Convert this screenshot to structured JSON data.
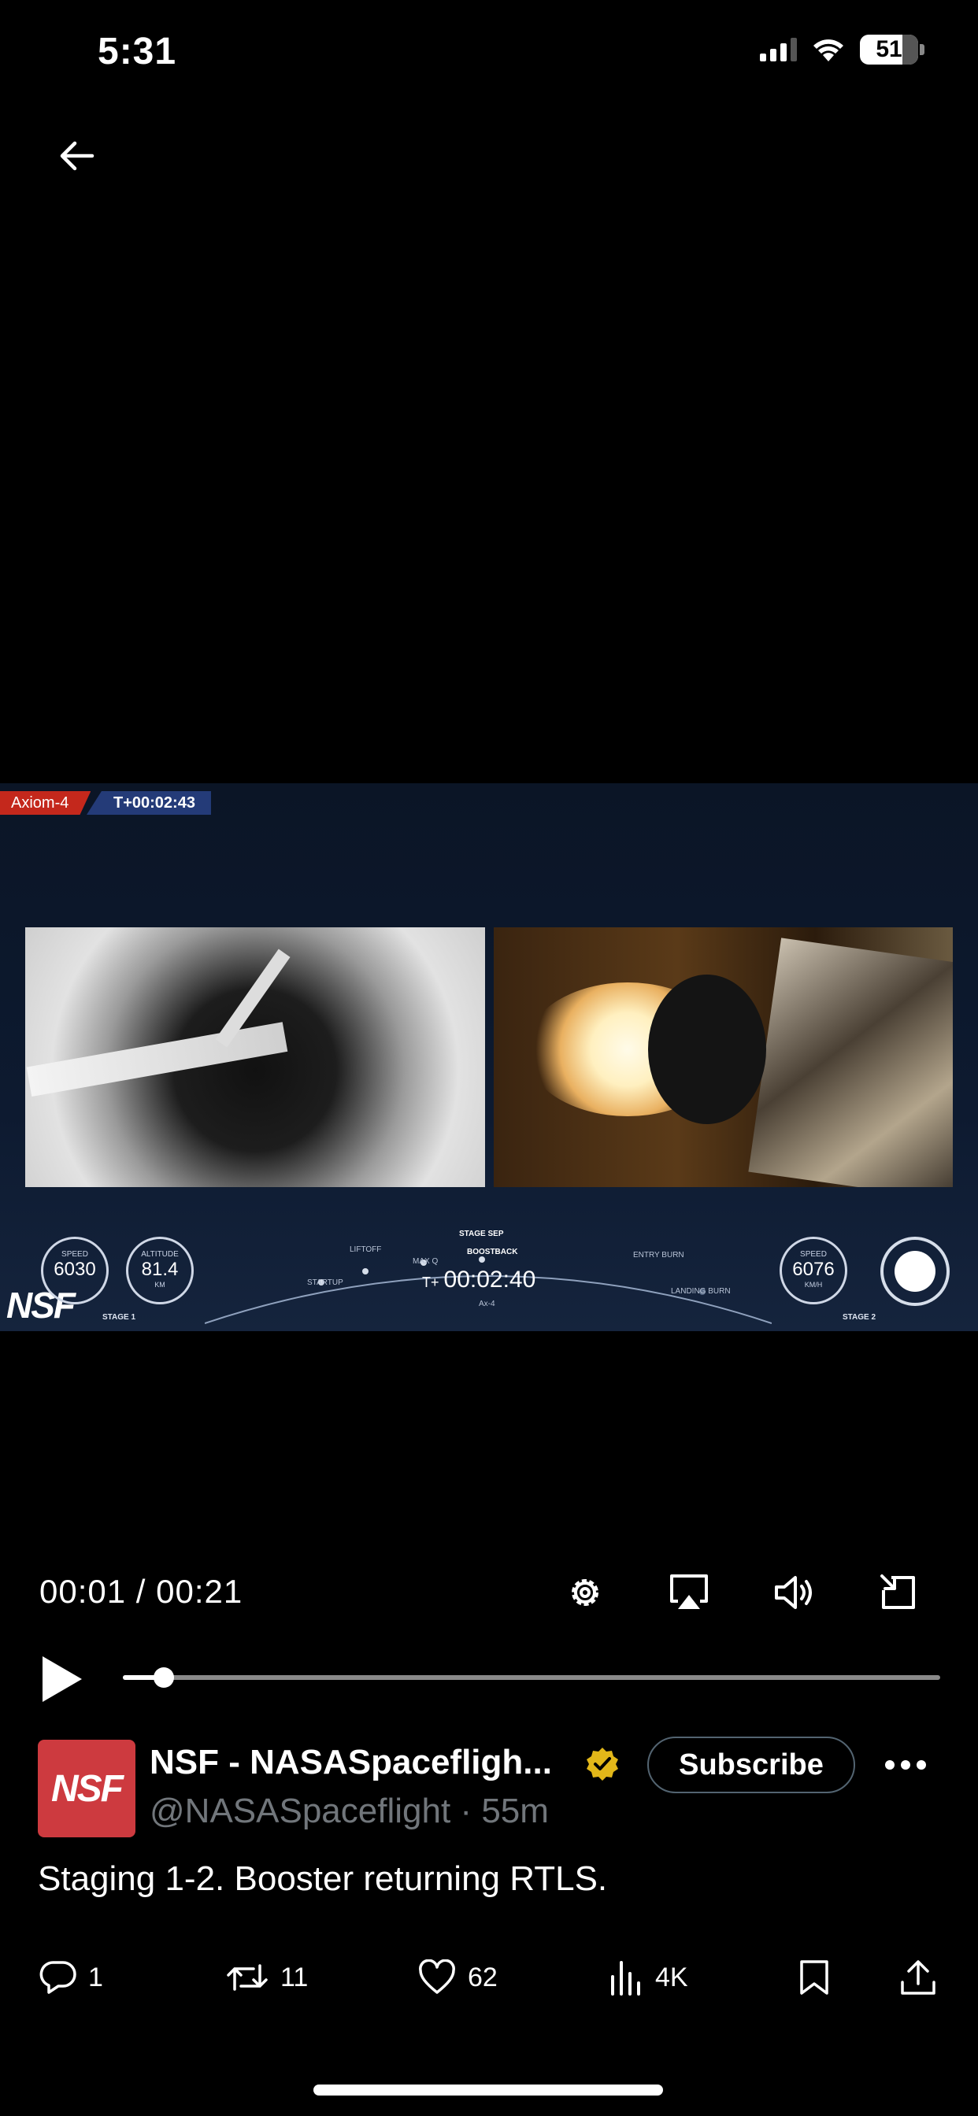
{
  "status_bar": {
    "time": "5:31",
    "battery": "51"
  },
  "video": {
    "mission_tag": "Axiom-4",
    "mission_clock": "T+00:02:43",
    "hud": {
      "logo": "NSF",
      "stage1": {
        "label": "STAGE 1",
        "speed_label": "SPEED",
        "speed_value": "6030",
        "altitude_label": "ALTITUDE",
        "altitude_value": "81.4",
        "altitude_unit": "KM"
      },
      "stage2": {
        "label": "STAGE 2",
        "speed_label": "SPEED",
        "speed_value": "6076",
        "speed_unit": "KM/H"
      },
      "clock_prefix": "T+",
      "clock": "00:02:40",
      "clock_sub": "Ax-4",
      "events": {
        "startup": "STARTUP",
        "liftoff": "LIFTOFF",
        "max_q": "MAX Q",
        "stage_sep": "STAGE SEP",
        "boostback": "BOOSTBACK",
        "entry_burn": "ENTRY BURN",
        "landing_burn": "LANDING BURN"
      }
    }
  },
  "player": {
    "time_readout": "00:01 / 00:21",
    "progress": 0.05,
    "icons": [
      "gear-icon",
      "airplay-icon",
      "volume-icon",
      "exit-fullscreen-icon",
      "play-icon"
    ]
  },
  "post": {
    "avatar_text": "NSF",
    "display_name": "NSF - NASASpacefligh...",
    "handle": "@NASASpaceflight",
    "separator": "·",
    "time_ago": "55m",
    "subscribe_label": "Subscribe",
    "text": "Staging 1-2. Booster returning RTLS.",
    "actions": {
      "replies": "1",
      "reposts": "11",
      "likes": "62",
      "views": "4K"
    }
  },
  "colors": {
    "avatar_bg": "#cd3a3f",
    "verified": "#e2b719",
    "secondary_text": "#71767b"
  }
}
